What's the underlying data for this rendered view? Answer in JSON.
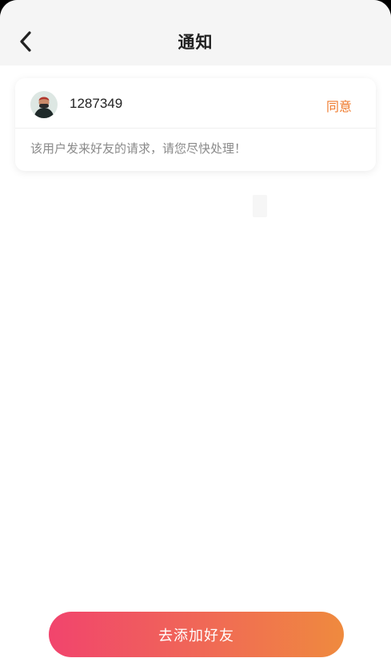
{
  "header": {
    "title": "通知",
    "back_icon": "chevron-left-icon"
  },
  "request": {
    "username": "1287349",
    "agree_label": "同意",
    "message": "该用户发来好友的请求，请您尽快处理！",
    "avatar_icon": "user-avatar"
  },
  "footer": {
    "add_friend_label": "去添加好友"
  },
  "colors": {
    "accent": "#ef7a2c",
    "button_gradient_start": "#f1446d",
    "button_gradient_end": "#ef8a3e"
  }
}
